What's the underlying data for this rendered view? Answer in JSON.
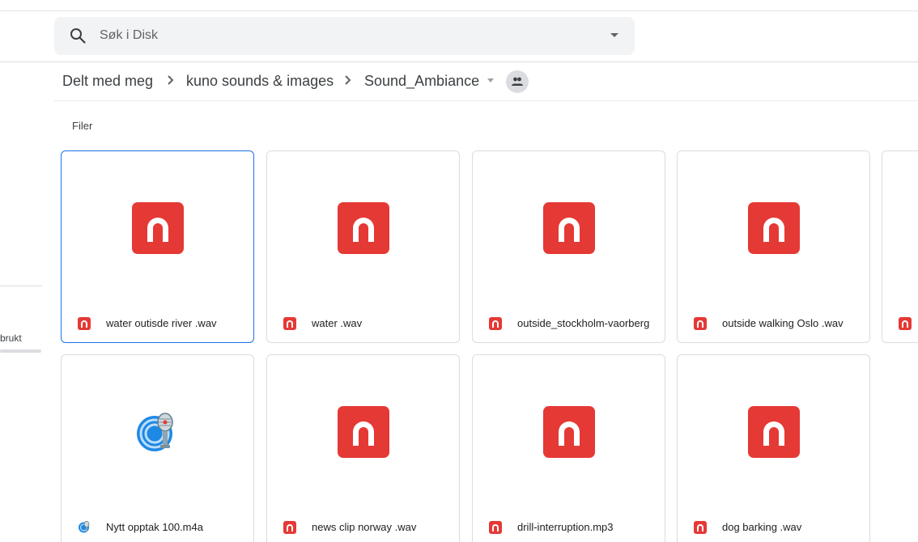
{
  "search": {
    "placeholder": "Søk i Disk"
  },
  "sidebar": {
    "storage_label": "brukt"
  },
  "breadcrumb": {
    "items": [
      {
        "label": "Delt med meg"
      },
      {
        "label": "kuno sounds & images"
      },
      {
        "label": "Sound_Ambiance"
      }
    ]
  },
  "files_section": {
    "label": "Filer"
  },
  "files": [
    {
      "name": "water outisde river .wav",
      "type": "audio-icon"
    },
    {
      "name": "water .wav",
      "type": "audio-icon"
    },
    {
      "name": "outside_stockholm-vaorberg",
      "type": "audio-icon"
    },
    {
      "name": "outside walking Oslo .wav",
      "type": "audio-icon"
    },
    {
      "name": "",
      "type": "audio-icon"
    },
    {
      "name": "Nytt opptak 100.m4a",
      "type": "microphone-icon"
    },
    {
      "name": "news clip norway .wav",
      "type": "audio-icon"
    },
    {
      "name": "drill-interruption.mp3",
      "type": "audio-icon"
    },
    {
      "name": "dog barking .wav",
      "type": "audio-icon"
    }
  ],
  "colors": {
    "accent": "#1a73e8",
    "audio_icon": "#e53935",
    "search_background": "#f1f3f4"
  }
}
